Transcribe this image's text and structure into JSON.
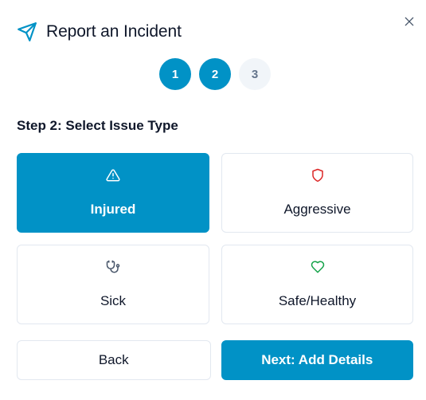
{
  "dialog": {
    "title": "Report an Incident",
    "header_icon": "send-icon",
    "close_icon": "close-icon"
  },
  "stepper": {
    "current": 2,
    "steps": [
      {
        "number": "1",
        "state": "completed"
      },
      {
        "number": "2",
        "state": "active"
      },
      {
        "number": "3",
        "state": "inactive"
      }
    ]
  },
  "step_title": "Step 2: Select Issue Type",
  "options": [
    {
      "label": "Injured",
      "icon": "alert-triangle-icon",
      "selected": true
    },
    {
      "label": "Aggressive",
      "icon": "shield-icon",
      "selected": false
    },
    {
      "label": "Sick",
      "icon": "stethoscope-icon",
      "selected": false
    },
    {
      "label": "Safe/Healthy",
      "icon": "heart-icon",
      "selected": false
    }
  ],
  "footer": {
    "back_label": "Back",
    "next_label": "Next: Add Details"
  },
  "colors": {
    "primary": "#0192c6",
    "aggressive_icon": "#dc2626",
    "safe_icon": "#16a34a",
    "sick_icon": "#475569",
    "inactive_step_bg": "#f1f5f9"
  }
}
